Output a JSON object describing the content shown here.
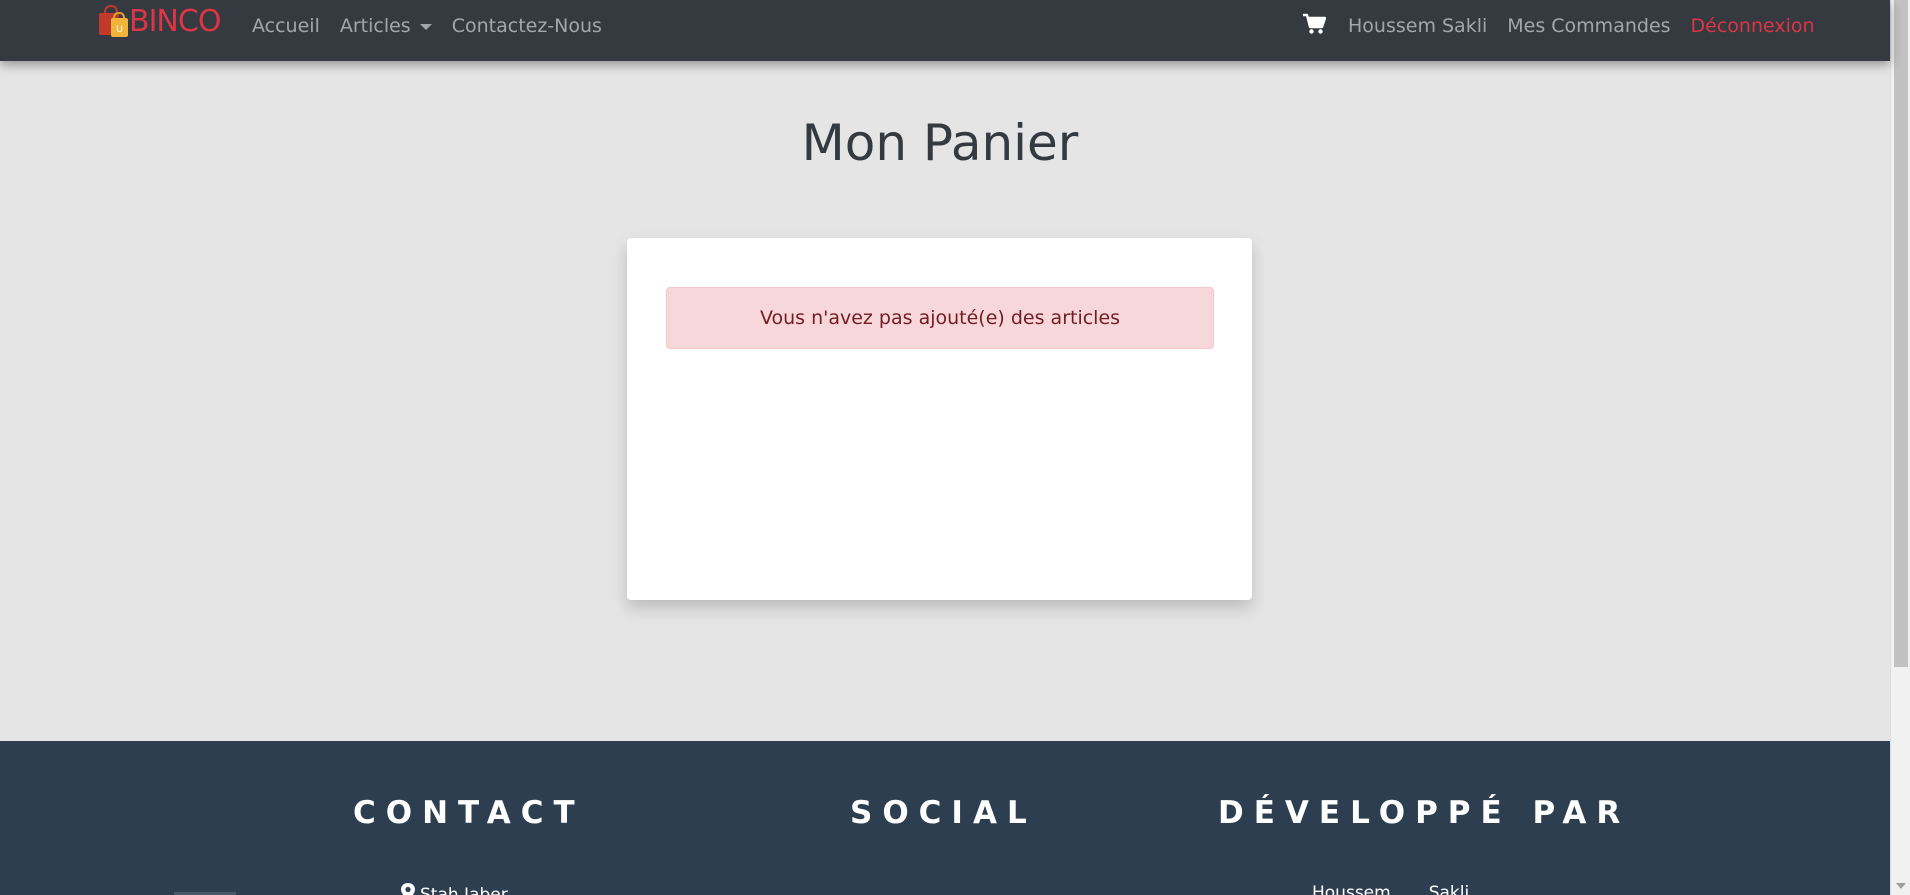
{
  "navbar": {
    "brand_text": "BINCO",
    "brand_bag_letter": "U",
    "links_left": {
      "home": "Accueil",
      "articles": "Articles",
      "contact": "Contactez-Nous"
    },
    "links_right": {
      "user": "Houssem Sakli",
      "orders": "Mes Commandes",
      "logout": "Déconnexion"
    },
    "icons": {
      "cart": "shopping-cart-icon",
      "articles_dropdown": "caret-down-icon"
    },
    "colors": {
      "background": "#343a40",
      "link": "rgba(255,255,255,0.55)",
      "brand": "#dc3545",
      "logout": "#dc3545"
    }
  },
  "main": {
    "title": "Mon Panier",
    "cart_alert": "Vous n'avez pas ajouté(e) des articles",
    "colors": {
      "page_background": "#e5e5e5",
      "alert_background": "#f8d7da",
      "alert_text": "#721c24"
    }
  },
  "footer": {
    "headings": {
      "contact": "CONTACT",
      "social": "SOCIAL",
      "developed_by": "DÉVELOPPÉ PAR"
    },
    "contact_location": "Stah Jaber",
    "developer_first_name": "Houssem",
    "developer_last_name": "Sakli",
    "icons": {
      "location": "map-marker-icon"
    },
    "colors": {
      "background": "#2c3e50",
      "text": "#ffffff"
    }
  }
}
